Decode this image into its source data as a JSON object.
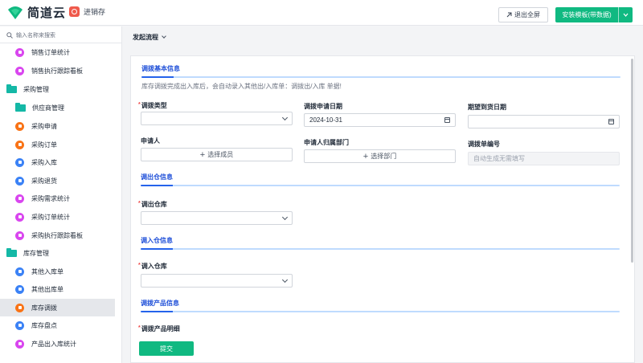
{
  "header": {
    "logo_text": "简道云",
    "app_name": "进销存",
    "exit_fullscreen": "退出全屏",
    "install_template": "安装模板(带数据)"
  },
  "sidebar": {
    "search_placeholder": "输入名称来搜索",
    "items": [
      {
        "label": "销售订单统计",
        "type": "sub",
        "color": "#d946ef"
      },
      {
        "label": "销售执行跟踪看板",
        "type": "sub",
        "color": "#d946ef"
      },
      {
        "label": "采购管理",
        "type": "group"
      },
      {
        "label": "供应商管理",
        "type": "folder-sub"
      },
      {
        "label": "采购申请",
        "type": "sub",
        "color": "#f97316"
      },
      {
        "label": "采购订单",
        "type": "sub",
        "color": "#f97316"
      },
      {
        "label": "采购入库",
        "type": "sub",
        "color": "#3b82f6"
      },
      {
        "label": "采购退货",
        "type": "sub",
        "color": "#3b82f6"
      },
      {
        "label": "采购需求统计",
        "type": "sub",
        "color": "#d946ef"
      },
      {
        "label": "采购订单统计",
        "type": "sub",
        "color": "#d946ef"
      },
      {
        "label": "采购执行跟踪看板",
        "type": "sub",
        "color": "#d946ef"
      },
      {
        "label": "库存管理",
        "type": "group"
      },
      {
        "label": "其他入库单",
        "type": "sub",
        "color": "#3b82f6"
      },
      {
        "label": "其他出库单",
        "type": "sub",
        "color": "#3b82f6"
      },
      {
        "label": "库存调拨",
        "type": "sub",
        "color": "#f97316",
        "active": true
      },
      {
        "label": "库存盘点",
        "type": "sub",
        "color": "#3b82f6"
      },
      {
        "label": "产品出入库统计",
        "type": "sub",
        "color": "#d946ef"
      }
    ]
  },
  "toolbar": {
    "start_flow": "发起流程"
  },
  "form": {
    "section_basic": "调拨基本信息",
    "basic_note": "库存调拨完成出入库后，会自动录入其他出/入库单：调拨出/入库 单据!",
    "transfer_type_label": "调拨类型",
    "apply_date_label": "调拨申请日期",
    "apply_date_value": "2024-10-31",
    "expected_date_label": "期望到货日期",
    "applicant_label": "申请人",
    "select_member": "选择成员",
    "applicant_dept_label": "申请人归属部门",
    "select_dept": "选择部门",
    "transfer_no_label": "调拨单编号",
    "transfer_no_placeholder": "自动生成无需填写",
    "section_out": "调出仓信息",
    "out_wh_label": "调出仓库",
    "section_in": "调入仓信息",
    "in_wh_label": "调入仓库",
    "section_product": "调拨产品信息",
    "product_detail_label": "调拨产品明细",
    "submit": "提交"
  }
}
